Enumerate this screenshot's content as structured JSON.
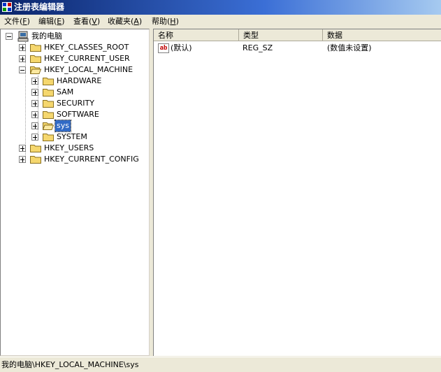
{
  "window": {
    "title": "注册表编辑器"
  },
  "menu": [
    {
      "label": "文件",
      "accel": "F"
    },
    {
      "label": "编辑",
      "accel": "E"
    },
    {
      "label": "查看",
      "accel": "V"
    },
    {
      "label": "收藏夹",
      "accel": "A"
    },
    {
      "label": "帮助",
      "accel": "H"
    }
  ],
  "tree": {
    "root": "我的电脑",
    "hives": [
      "HKEY_CLASSES_ROOT",
      "HKEY_CURRENT_USER",
      "HKEY_LOCAL_MACHINE",
      "HKEY_USERS",
      "HKEY_CURRENT_CONFIG"
    ],
    "hklm_children": [
      "HARDWARE",
      "SAM",
      "SECURITY",
      "SOFTWARE",
      "sys",
      "SYSTEM"
    ],
    "selected": "sys"
  },
  "list": {
    "columns": [
      "名称",
      "类型",
      "数据"
    ],
    "rows": [
      {
        "icon": "ab",
        "name": "(默认)",
        "type": "REG_SZ",
        "data": "(数值未设置)"
      }
    ]
  },
  "status": {
    "path": "我的电脑\\HKEY_LOCAL_MACHINE\\sys"
  },
  "colors": {
    "selection": "#316ac5",
    "folder": "#f5d76e",
    "titlebar": "#0a246a"
  }
}
